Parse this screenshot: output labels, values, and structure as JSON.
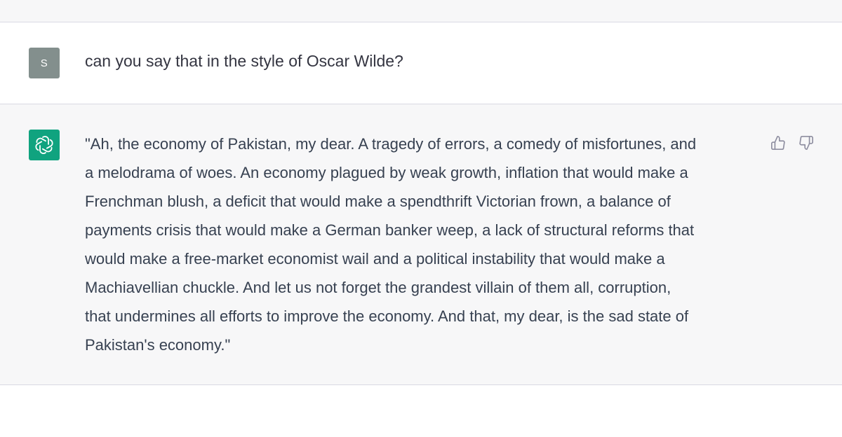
{
  "user": {
    "avatar_initial": "S",
    "message": "can you say that in the style of Oscar Wilde?"
  },
  "assistant": {
    "lines": [
      "\"Ah, the economy of Pakistan, my dear. A tragedy of errors, a comedy of misfortunes, and",
      "a melodrama of woes. An economy plagued by weak growth, inflation that would make a",
      "Frenchman blush, a deficit that would make a spendthrift Victorian frown, a balance of",
      "payments crisis that would make a German banker weep, a lack of structural reforms that",
      "would make a free-market economist wail and a political instability that would make a",
      "Machiavellian chuckle. And let us not forget the grandest villain of them all, corruption,",
      "that undermines all efforts to improve the economy. And that, my dear, is the sad state of",
      "Pakistan's economy.\""
    ]
  },
  "feedback": {
    "thumbs_up_icon": "thumbs-up-icon",
    "thumbs_down_icon": "thumbs-down-icon"
  },
  "colors": {
    "assistant_avatar_bg": "#10a37f",
    "user_avatar_bg": "#838f8d",
    "assistant_bg": "#f7f7f8",
    "text": "#374151"
  }
}
